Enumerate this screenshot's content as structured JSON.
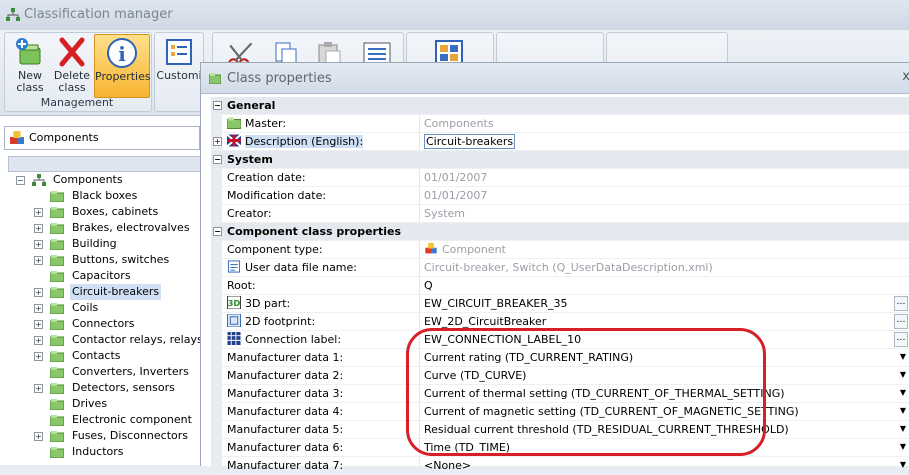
{
  "app": {
    "title": "Classification manager"
  },
  "ribbon": {
    "new_class": "New\nclass",
    "delete_class": "Delete\nclass",
    "properties": "Properties",
    "customize": "Customi",
    "group_management": "Management"
  },
  "left": {
    "combo_value": "Components",
    "tree": [
      {
        "label": "Components",
        "root": true,
        "expanded": true
      },
      {
        "label": "Black boxes",
        "has_children": false
      },
      {
        "label": "Boxes, cabinets",
        "has_children": true
      },
      {
        "label": "Brakes, electrovalves",
        "has_children": true
      },
      {
        "label": "Building",
        "has_children": true
      },
      {
        "label": "Buttons, switches",
        "has_children": true
      },
      {
        "label": "Capacitors",
        "has_children": false
      },
      {
        "label": "Circuit-breakers",
        "has_children": true,
        "selected": true
      },
      {
        "label": "Coils",
        "has_children": true
      },
      {
        "label": "Connectors",
        "has_children": true
      },
      {
        "label": "Contactor relays, relays",
        "has_children": true
      },
      {
        "label": "Contacts",
        "has_children": true
      },
      {
        "label": "Converters, Inverters",
        "has_children": false
      },
      {
        "label": "Detectors, sensors",
        "has_children": true
      },
      {
        "label": "Drives",
        "has_children": false
      },
      {
        "label": "Electronic component",
        "has_children": false
      },
      {
        "label": "Fuses, Disconnectors",
        "has_children": true
      },
      {
        "label": "Inductors",
        "has_children": false
      }
    ]
  },
  "dialog": {
    "title": "Class properties",
    "close": "x",
    "rows": [
      {
        "type": "cat",
        "name": "General"
      },
      {
        "name": "Master:",
        "value": "Components",
        "gray": true,
        "icon": "folder"
      },
      {
        "name": "Description (English):",
        "value": "Circuit-breakers",
        "icon": "flag",
        "expand": true,
        "highlight": true
      },
      {
        "type": "cat",
        "name": "System"
      },
      {
        "name": "Creation date:",
        "value": "01/01/2007",
        "gray": true
      },
      {
        "name": "Modification date:",
        "value": "01/01/2007",
        "gray": true
      },
      {
        "name": "Creator:",
        "value": "System",
        "gray": true
      },
      {
        "type": "cat",
        "name": "Component class properties"
      },
      {
        "name": "Component type:",
        "value": "Component",
        "gray": true,
        "value_icon": "cubes"
      },
      {
        "name": "User data file name:",
        "value": "Circuit-breaker, Switch (Q_UserDataDescription.xml)",
        "gray": true,
        "icon": "doc"
      },
      {
        "name": "Root:",
        "value": "Q"
      },
      {
        "name": "3D part:",
        "value": "EW_CIRCUIT_BREAKER_35",
        "icon": "3d",
        "button": "ellipsis"
      },
      {
        "name": "2D footprint:",
        "value": "EW_2D_CircuitBreaker",
        "icon": "2d",
        "button": "ellipsis"
      },
      {
        "name": "Connection label:",
        "value": "EW_CONNECTION_LABEL_10",
        "icon": "grid",
        "button": "ellipsis"
      },
      {
        "name": "Manufacturer data 1:",
        "value": "Current rating (TD_CURRENT_RATING)",
        "button": "dropdown"
      },
      {
        "name": "Manufacturer data 2:",
        "value": "Curve (TD_CURVE)",
        "button": "dropdown"
      },
      {
        "name": "Manufacturer data 3:",
        "value": "Current of thermal setting (TD_CURRENT_OF_THERMAL_SETTING)",
        "button": "dropdown"
      },
      {
        "name": "Manufacturer data 4:",
        "value": "Current of magnetic setting (TD_CURRENT_OF_MAGNETIC_SETTING)",
        "button": "dropdown"
      },
      {
        "name": "Manufacturer data 5:",
        "value": "Residual current threshold (TD_RESIDUAL_CURRENT_THRESHOLD)",
        "button": "dropdown"
      },
      {
        "name": "Manufacturer data 6:",
        "value": "Time (TD_TIME)",
        "button": "dropdown"
      },
      {
        "name": "Manufacturer data 7:",
        "value": "<None>",
        "button": "dropdown"
      }
    ]
  },
  "colors": {
    "annotation": "#d61f26",
    "selection": "#cfe0f5",
    "ribbon_active": "#f7b431"
  }
}
